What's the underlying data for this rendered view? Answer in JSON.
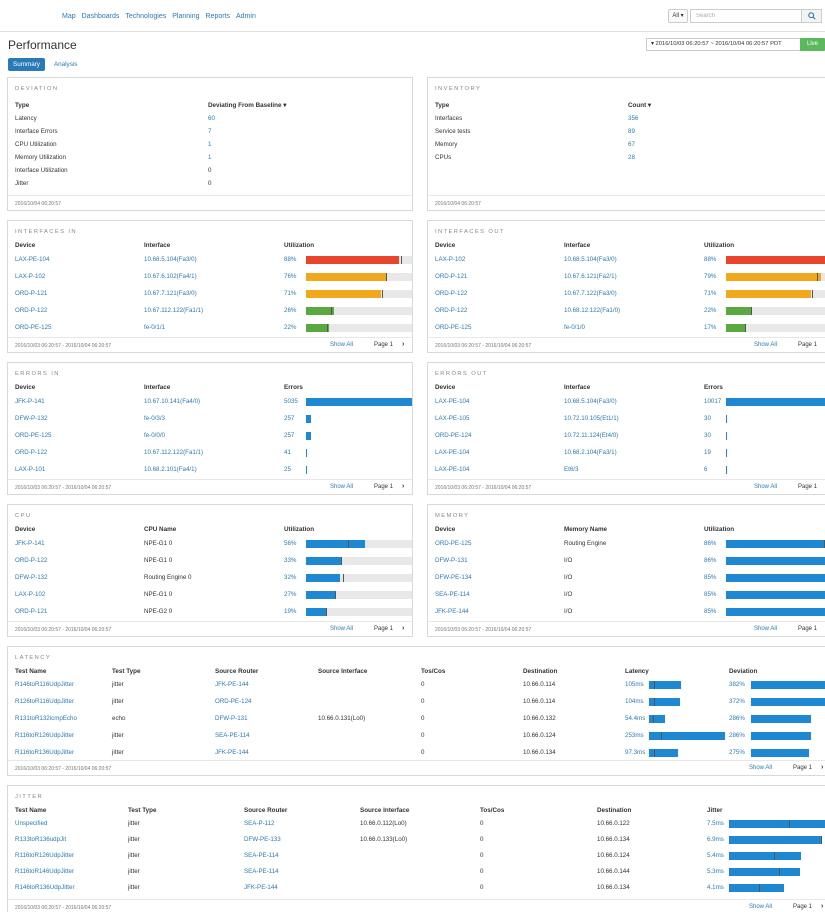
{
  "nav": [
    "Map",
    "Dashboards",
    "Technologies",
    "Planning",
    "Reports",
    "Admin"
  ],
  "search": {
    "scope": "All ▾",
    "placeholder": "Search"
  },
  "page_title": "Performance",
  "time_range": "▾ 2016/10/03 06:20:57 ~ 2016/10/04 06:20:57 PDT",
  "live_label": "Live",
  "tabs": [
    "Summary",
    "Analysis"
  ],
  "footer": {
    "range": "2016/10/03 06:20:57 - 2016/10/04 06:20:57",
    "show_all": "Show All",
    "page": "Page 1"
  },
  "deviation": {
    "title": "DEVIATION",
    "headers": [
      "Type",
      "Deviating From Baseline ▾"
    ],
    "rows": [
      [
        "Latency",
        "60"
      ],
      [
        "Interface Errors",
        "7"
      ],
      [
        "CPU Utilization",
        "1"
      ],
      [
        "Memory Utilization",
        "1"
      ],
      [
        "Interface Utilization",
        "0"
      ],
      [
        "Jitter",
        "0"
      ]
    ],
    "timestamp": "2016/10/04 06:20:57"
  },
  "inventory": {
    "title": "INVENTORY",
    "headers": [
      "Type",
      "Count ▾"
    ],
    "rows": [
      [
        "Interfaces",
        "356"
      ],
      [
        "Service tests",
        "89"
      ],
      [
        "Memory",
        "67"
      ],
      [
        "CPUs",
        "28"
      ]
    ],
    "timestamp": "2016/10/04 06:20:57"
  },
  "interfaces_in": {
    "title": "INTERFACES IN",
    "headers": [
      "Device",
      "Interface",
      "Utilization"
    ],
    "rows": [
      {
        "device": "LAX-PE-104",
        "iface": "10.68.5.104(Fa3/0)",
        "label": "88%",
        "pct": 88,
        "color": "#e8452c",
        "mark": 90
      },
      {
        "device": "LAX-P-102",
        "iface": "10.67.6.102(Fa4/1)",
        "label": "76%",
        "pct": 76,
        "color": "#f2a81d",
        "mark": 75
      },
      {
        "device": "ORD-P-121",
        "iface": "10.67.7.121(Fa3/0)",
        "label": "71%",
        "pct": 71,
        "color": "#f2a81d",
        "mark": 72
      },
      {
        "device": "ORD-P-122",
        "iface": "10.67.112.122(Fa1/1)",
        "label": "26%",
        "pct": 26,
        "color": "#5aa83f",
        "mark": 24
      },
      {
        "device": "ORD-PE-125",
        "iface": "fe-0/1/1",
        "label": "22%",
        "pct": 22,
        "color": "#5aa83f",
        "mark": 20
      }
    ]
  },
  "interfaces_out": {
    "title": "INTERFACES OUT",
    "headers": [
      "Device",
      "Interface",
      "Utilization"
    ],
    "rows": [
      {
        "device": "LAX-P-102",
        "iface": "10.68.5.104(Fa3/0)",
        "label": "88%",
        "pct": 88,
        "color": "#e8452c",
        "mark": 90
      },
      {
        "device": "ORD-P-121",
        "iface": "10.67.6.121(Fa2/1)",
        "label": "79%",
        "pct": 79,
        "color": "#f2a81d",
        "mark": 76
      },
      {
        "device": "ORD-P-122",
        "iface": "10.67.7.122(Fa3/0)",
        "label": "71%",
        "pct": 71,
        "color": "#f2a81d",
        "mark": 72
      },
      {
        "device": "ORD-P-122",
        "iface": "10.68.12.122(Fa1/0)",
        "label": "22%",
        "pct": 22,
        "color": "#5aa83f",
        "mark": 21
      },
      {
        "device": "ORD-PE-125",
        "iface": "fe-0/1/0",
        "label": "17%",
        "pct": 17,
        "color": "#5aa83f",
        "mark": 16
      }
    ]
  },
  "errors_in": {
    "title": "ERRORS IN",
    "headers": [
      "Device",
      "Interface",
      "Errors"
    ],
    "rows": [
      {
        "device": "JFK-P-141",
        "iface": "10.67.10.141(Fa4/0)",
        "label": "5035",
        "pct": 100
      },
      {
        "device": "DFW-P-132",
        "iface": "fe-0/3/3",
        "label": "257",
        "pct": 5
      },
      {
        "device": "ORD-PE-125",
        "iface": "fe-0/0/0",
        "label": "257",
        "pct": 5
      },
      {
        "device": "ORD-P-122",
        "iface": "10.67.112.122(Fa1/1)",
        "label": "41",
        "pct": 1
      },
      {
        "device": "LAX-P-101",
        "iface": "10.68.2.101(Fa4/1)",
        "label": "25",
        "pct": 1
      }
    ]
  },
  "errors_out": {
    "title": "ERRORS OUT",
    "headers": [
      "Device",
      "Interface",
      "Errors"
    ],
    "rows": [
      {
        "device": "LAX-PE-104",
        "iface": "10.68.5.104(Fa3/0)",
        "label": "10017",
        "pct": 100
      },
      {
        "device": "LAX-PE-105",
        "iface": "10.72.10.105(Et1/1)",
        "label": "30",
        "pct": 1
      },
      {
        "device": "ORD-PE-124",
        "iface": "10.72.11.124(Et4/0)",
        "label": "30",
        "pct": 1
      },
      {
        "device": "LAX-PE-104",
        "iface": "10.68.2.104(Fa3/1)",
        "label": "19",
        "pct": 1
      },
      {
        "device": "LAX-PE-104",
        "iface": "Et6/3",
        "label": "6",
        "pct": 1
      }
    ]
  },
  "cpu": {
    "title": "CPU",
    "headers": [
      "Device",
      "CPU Name",
      "Utilization"
    ],
    "rows": [
      {
        "device": "JFK-P-141",
        "name": "NPE-G1 0",
        "label": "56%",
        "pct": 56,
        "mark": 40
      },
      {
        "device": "ORD-P-122",
        "name": "NPE-G1 0",
        "label": "33%",
        "pct": 33,
        "mark": 33
      },
      {
        "device": "DFW-P-132",
        "name": "Routing Engine 0",
        "label": "32%",
        "pct": 32,
        "mark": 35
      },
      {
        "device": "LAX-P-102",
        "name": "NPE-G1 0",
        "label": "27%",
        "pct": 27,
        "mark": 27
      },
      {
        "device": "ORD-P-121",
        "name": "NPE-G2 0",
        "label": "19%",
        "pct": 19,
        "mark": 19
      }
    ]
  },
  "memory": {
    "title": "MEMORY",
    "headers": [
      "Device",
      "Memory Name",
      "Utilization"
    ],
    "rows": [
      {
        "device": "ORD-PE-125",
        "name": "Routing Engine",
        "label": "86%",
        "pct": 86,
        "mark": 82
      },
      {
        "device": "DFW-P-131",
        "name": "I/O",
        "label": "86%",
        "pct": 86,
        "mark": 84
      },
      {
        "device": "DFW-PE-134",
        "name": "I/O",
        "label": "85%",
        "pct": 85,
        "mark": 85
      },
      {
        "device": "SEA-PE-114",
        "name": "I/O",
        "label": "85%",
        "pct": 85,
        "mark": 85
      },
      {
        "device": "JFK-PE-144",
        "name": "I/O",
        "label": "85%",
        "pct": 85,
        "mark": 85
      }
    ]
  },
  "latency": {
    "title": "LATENCY",
    "headers": [
      "Test Name",
      "Test Type",
      "Source Router",
      "Source Interface",
      "Tos/Cos",
      "Destination",
      "Latency",
      "Deviation"
    ],
    "rows": [
      {
        "name": "R146toR116UdpJitter",
        "type": "jitter",
        "router": "JFK-PE-144",
        "src": "",
        "tos": "0",
        "dest": "10.66.0.114",
        "lat": "105ms",
        "lat_pct": 42,
        "lat_mark": 6,
        "dev": "382%",
        "dev_pct": 100
      },
      {
        "name": "R126toR116UdpJitter",
        "type": "jitter",
        "router": "ORD-PE-124",
        "src": "",
        "tos": "0",
        "dest": "10.66.0.114",
        "lat": "104ms",
        "lat_pct": 41,
        "lat_mark": 6,
        "dev": "372%",
        "dev_pct": 97
      },
      {
        "name": "R131toR132icmpEcho",
        "type": "echo",
        "router": "DFW-P-131",
        "src": "10.66.0.131(Lo0)",
        "tos": "0",
        "dest": "10.66.0.132",
        "lat": "54.4ms",
        "lat_pct": 21,
        "lat_mark": 5,
        "dev": "286%",
        "dev_pct": 75
      },
      {
        "name": "R116toR126UdpJitter",
        "type": "jitter",
        "router": "SEA-PE-114",
        "src": "",
        "tos": "0",
        "dest": "10.66.0.124",
        "lat": "253ms",
        "lat_pct": 100,
        "lat_mark": 16,
        "dev": "286%",
        "dev_pct": 75
      },
      {
        "name": "R116toR136UdpJitter",
        "type": "jitter",
        "router": "JFK-PE-144",
        "src": "",
        "tos": "0",
        "dest": "10.66.0.134",
        "lat": "97.3ms",
        "lat_pct": 38,
        "lat_mark": 6,
        "dev": "275%",
        "dev_pct": 72
      }
    ]
  },
  "jitter": {
    "title": "JITTER",
    "headers": [
      "Test Name",
      "Test Type",
      "Source Router",
      "Source Interface",
      "Tos/Cos",
      "Destination",
      "Jitter"
    ],
    "rows": [
      {
        "name": "Unspecified",
        "type": "jitter",
        "router": "SEA-P-112",
        "src": "10.66.0.112(Lo0)",
        "tos": "0",
        "dest": "10.66.0.122",
        "val": "7.5ms",
        "pct": 100,
        "mark": 60
      },
      {
        "name": "R133toR136udpJit",
        "type": "jitter",
        "router": "DFW-PE-133",
        "src": "10.66.0.133(Lo0)",
        "tos": "0",
        "dest": "10.66.0.134",
        "val": "6.9ms",
        "pct": 92,
        "mark": 92
      },
      {
        "name": "R116toR126UdpJitter",
        "type": "jitter",
        "router": "SEA-PE-114",
        "src": "",
        "tos": "0",
        "dest": "10.66.0.124",
        "val": "5.4ms",
        "pct": 72,
        "mark": 45
      },
      {
        "name": "R116toR146UdpJitter",
        "type": "jitter",
        "router": "SEA-PE-114",
        "src": "",
        "tos": "0",
        "dest": "10.66.0.144",
        "val": "5.3ms",
        "pct": 71,
        "mark": 50
      },
      {
        "name": "R146toR136UdpJitter",
        "type": "jitter",
        "router": "JFK-PE-144",
        "src": "",
        "tos": "0",
        "dest": "10.66.0.134",
        "val": "4.1ms",
        "pct": 55,
        "mark": 30
      }
    ]
  },
  "colors": {
    "link": "#2a7ab8",
    "bar_blue": "#1e88d2",
    "live": "#5cb85c"
  }
}
